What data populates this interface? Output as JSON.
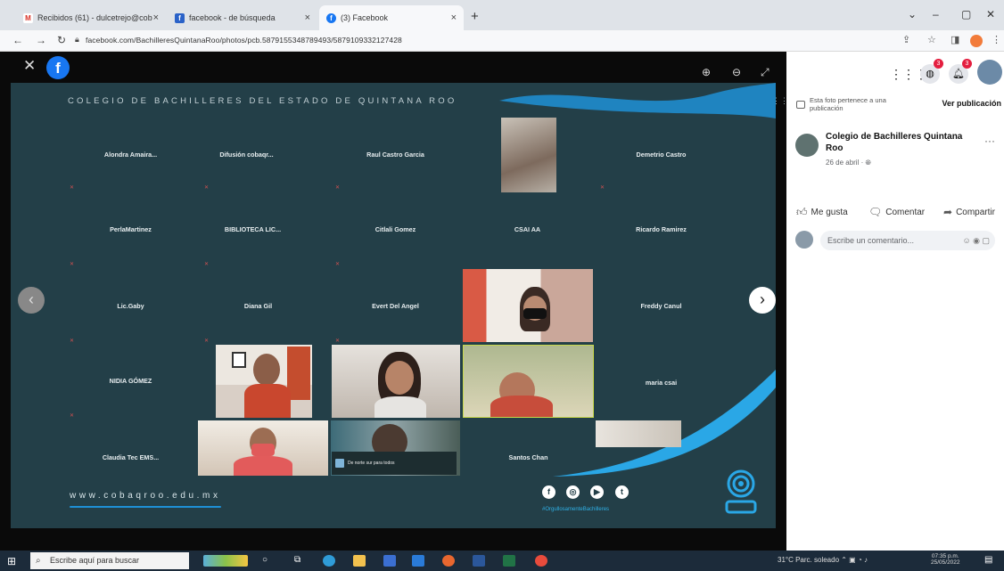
{
  "browser": {
    "tabs": [
      {
        "label": "Recibidos (61) - dulcetrejo@cob",
        "icon": "gmail-icon"
      },
      {
        "label": "facebook - de búsqueda",
        "icon": "search-favicon"
      },
      {
        "label": "(3) Facebook",
        "icon": "facebook-icon"
      }
    ],
    "url": "facebook.com/BachilleresQuintanaRoo/photos/pcb.5879155348789493/5879109332127428"
  },
  "viewer": {
    "slide_title": "COLEGIO DE BACHILLERES DEL ESTADO DE QUINTANA ROO",
    "footer_url": "www.cobaqroo.edu.mx",
    "hashtag": "#OrgullosamenteBachilleres",
    "caption": "De norte sur para todos",
    "participants": [
      "Alondra Amaira...",
      "Difusión cobaqr...",
      "Raul Castro Garcia",
      "Demetrio Castro",
      "PerlaMartinez",
      "BIBLIOTECA LIC...",
      "Citlali Gomez",
      "CSAI AA",
      "Ricardo Ramirez",
      "Lic.Gaby",
      "Diana Gil",
      "Evert Del Angel",
      "Freddy Canul",
      "NIDIA GÓMEZ",
      "maria csai",
      "Claudia Tec EMS...",
      "Santos Chan"
    ]
  },
  "sidebar": {
    "post_note": "Esta foto pertenece a una publicación",
    "view_post": "Ver publicación",
    "page_name": "Colegio de Bachilleres Quintana Roo",
    "date": "26 de abril ·",
    "like": "Me gusta",
    "comment": "Comentar",
    "share": "Compartir",
    "comment_placeholder": "Escribe un comentario..."
  },
  "taskbar": {
    "search_placeholder": "Escribe aquí para buscar",
    "weather": "31°C Parc. soleado",
    "time": "07:35 p.m.",
    "date": "25/05/2022"
  },
  "colors": {
    "slide_bg": "#233f48",
    "accent": "#1e90d6",
    "facebook": "#1877f2"
  }
}
